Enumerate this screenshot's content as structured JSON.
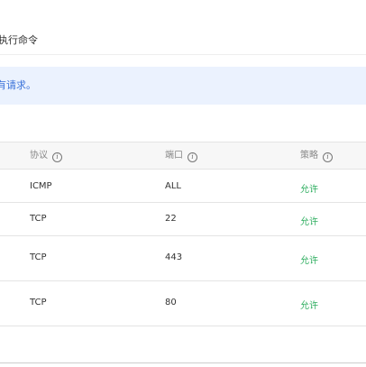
{
  "tabs": {
    "exec_command": "执行命令"
  },
  "banner": {
    "text": "有请求。"
  },
  "table": {
    "headers": {
      "protocol": "协议",
      "port": "端口",
      "policy": "策略"
    },
    "rows": [
      {
        "protocol": "ICMP",
        "port": "ALL",
        "policy": "允许"
      },
      {
        "protocol": "TCP",
        "port": "22",
        "policy": "允许"
      },
      {
        "protocol": "TCP",
        "port": "443",
        "policy": "允许"
      },
      {
        "protocol": "TCP",
        "port": "80",
        "policy": "允许"
      }
    ]
  },
  "colors": {
    "allow": "#2fae60",
    "banner_bg": "#ebf2fe",
    "banner_text": "#3a72d9"
  },
  "icons": {
    "header_help": "info-circle-icon"
  }
}
